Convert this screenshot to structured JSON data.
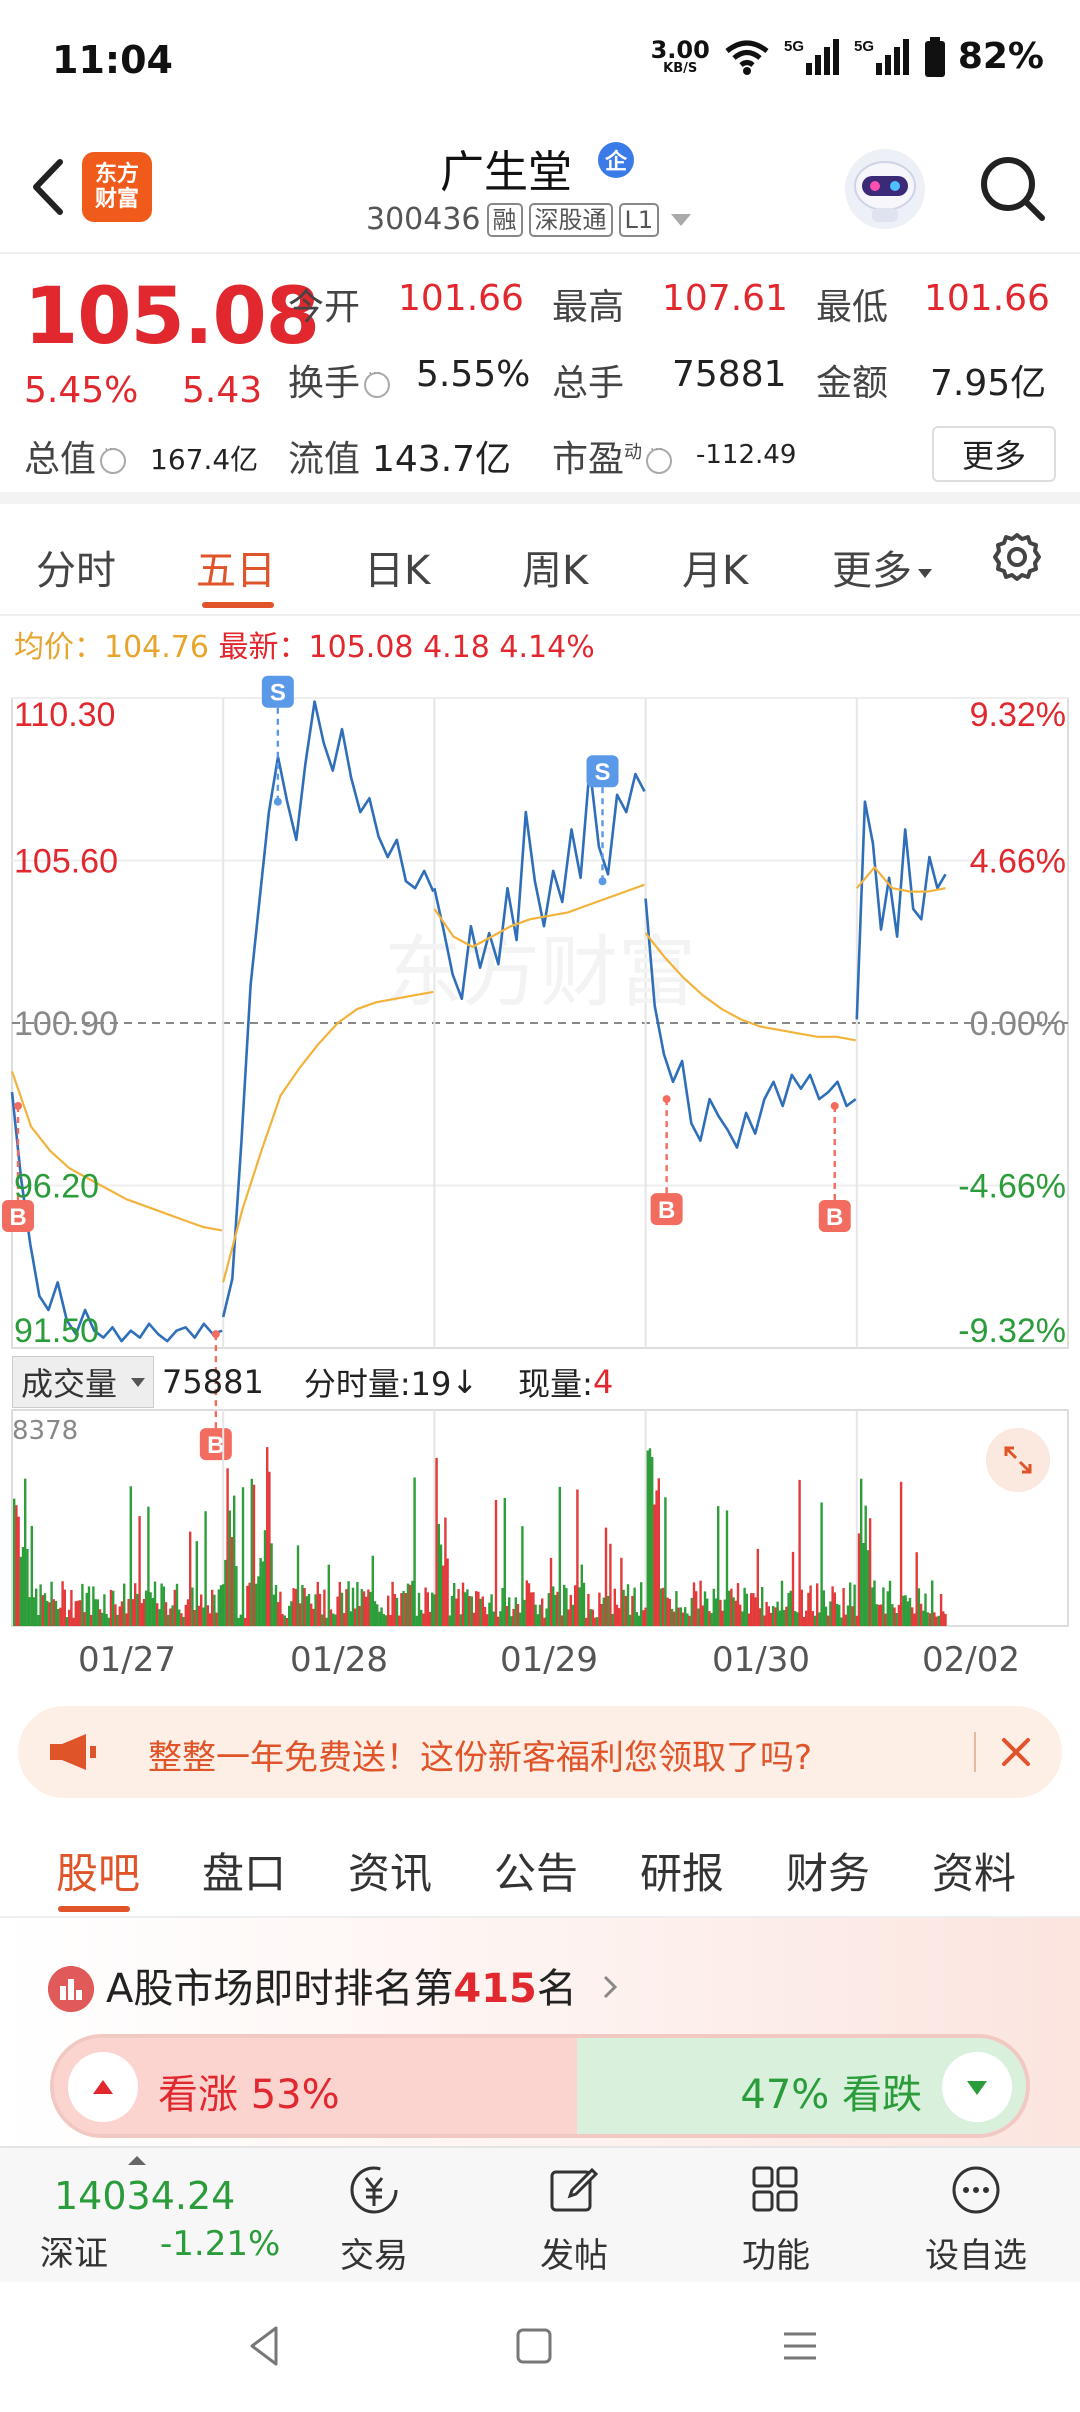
{
  "status": {
    "time": "11:04",
    "net_speed": "3.00",
    "net_unit": "KB/S",
    "signal1": "5G",
    "signal2": "5G",
    "battery": "82%"
  },
  "header": {
    "logo_line1": "东方",
    "logo_line2": "财富",
    "stock_name": "广生堂",
    "qi_badge": "企",
    "code": "300436",
    "tags": [
      "融",
      "深股通",
      "L1"
    ]
  },
  "quote": {
    "price": "105.08",
    "change_pct": "5.45%",
    "change": "5.43",
    "open_label": "今开",
    "open": "101.66",
    "high_label": "最高",
    "high": "107.61",
    "low_label": "最低",
    "low": "101.66",
    "turnover_label": "换手",
    "turnover": "5.55%",
    "volume_label": "总手",
    "volume": "75881",
    "amount_label": "金额",
    "amount": "7.95亿",
    "mcap_label": "总值",
    "mcap": "167.4亿",
    "float_label": "流值",
    "float": "143.7亿",
    "pe_label": "市盈",
    "pe_sup": "动",
    "pe": "-112.49",
    "more": "更多"
  },
  "period_tabs": [
    "分时",
    "五日",
    "日K",
    "周K",
    "月K",
    "更多"
  ],
  "avg": {
    "avg_label": "均价：",
    "avg_value": "104.76",
    "latest_label": "最新：",
    "latest_value": "105.08",
    "latest_change": "4.18",
    "latest_pct": "4.14%"
  },
  "chart_data": {
    "type": "line",
    "title": "",
    "dates": [
      "01/27",
      "01/28",
      "01/29",
      "01/30",
      "02/02"
    ],
    "ylim": [
      91.5,
      110.3
    ],
    "y_ticks_left": [
      "110.30",
      "105.60",
      "100.90",
      "96.20",
      "91.50"
    ],
    "y_ticks_right": [
      "9.32%",
      "4.66%",
      "0.00%",
      "-4.66%",
      "-9.32%"
    ],
    "reference_price": 100.9,
    "series": [
      {
        "color": "#2f6fba",
        "days": [
          [
            98.9,
            96.4,
            94.5,
            93.0,
            92.6,
            93.4,
            92.3,
            91.9,
            92.6,
            92.0,
            91.8,
            92.1,
            91.7,
            92.0,
            91.8,
            92.2,
            91.9,
            91.7,
            92.0,
            92.1,
            91.8,
            92.2,
            91.9,
            92.0
          ],
          [
            92.4,
            93.5,
            97.5,
            102.0,
            104.5,
            107.0,
            108.6,
            107.3,
            106.2,
            108.4,
            110.2,
            109.0,
            108.2,
            109.4,
            108.0,
            107.0,
            107.4,
            106.3,
            105.7,
            106.2,
            105.0,
            104.8,
            105.3,
            104.7
          ],
          [
            104.8,
            103.6,
            102.3,
            101.6,
            103.7,
            102.5,
            103.5,
            102.6,
            104.8,
            103.3,
            107.0,
            105.0,
            103.7,
            105.3,
            104.4,
            106.5,
            105.1,
            108.3,
            106.0,
            105.2,
            107.5,
            107.0,
            108.1,
            107.6
          ],
          [
            104.5,
            101.4,
            100.0,
            99.2,
            99.8,
            98.0,
            97.5,
            98.7,
            98.2,
            97.8,
            97.3,
            98.3,
            97.7,
            98.7,
            99.2,
            98.5,
            99.4,
            99.0,
            99.4,
            98.7,
            98.9,
            99.2,
            98.5,
            98.7
          ],
          [
            101.0,
            107.3,
            106.1,
            103.6,
            105.1,
            103.4,
            106.5,
            104.2,
            103.9,
            105.7,
            104.8,
            105.2
          ]
        ]
      },
      {
        "color": "#f2b33d",
        "days": [
          [
            99.5,
            97.9,
            97.2,
            96.7,
            96.4,
            96.1,
            95.8,
            95.6,
            95.4,
            95.2,
            95.0,
            94.9
          ],
          [
            93.4,
            95.5,
            97.2,
            98.8,
            99.6,
            100.3,
            100.9,
            101.3,
            101.5,
            101.6,
            101.7,
            101.8
          ],
          [
            104.2,
            103.4,
            103.1,
            103.4,
            103.7,
            103.9,
            104.0,
            104.1,
            104.3,
            104.5,
            104.7,
            104.9
          ],
          [
            103.5,
            102.8,
            102.2,
            101.7,
            101.3,
            101.0,
            100.8,
            100.7,
            100.6,
            100.5,
            100.5,
            100.4
          ],
          [
            104.8,
            105.4,
            104.8,
            104.7,
            104.7,
            104.8
          ]
        ]
      }
    ],
    "markers": [
      {
        "label": "B",
        "day": 0,
        "pos": 0.0,
        "price": 98.5
      },
      {
        "label": "B",
        "day": 0,
        "pos": 0.97,
        "price": 91.9
      },
      {
        "label": "S",
        "day": 1,
        "pos": 0.26,
        "price": 107.3
      },
      {
        "label": "S",
        "day": 2,
        "pos": 0.8,
        "price": 105.0
      },
      {
        "label": "B",
        "day": 3,
        "pos": 0.1,
        "price": 98.7
      },
      {
        "label": "B",
        "day": 3,
        "pos": 0.9,
        "price": 98.5
      }
    ],
    "volume": {
      "label": "成交量",
      "total": "75881",
      "period_label": "分时量:19",
      "period_arrow": "↓",
      "current_label": "现量:",
      "current": "4",
      "max": "8378"
    }
  },
  "promo": {
    "text": "整整一年免费送！这份新客福利您领取了吗?"
  },
  "bottom_tabs": [
    "股吧",
    "盘口",
    "资讯",
    "公告",
    "研报",
    "财务",
    "资料"
  ],
  "rank": {
    "prefix": "A股市场即时排名第",
    "num": "415",
    "suffix": "名"
  },
  "vote": {
    "up_text": "看涨 53%",
    "down_text": "47% 看跌",
    "up_pct": 53
  },
  "nav": {
    "index_value": "14034.24",
    "index_name": "深证",
    "index_pct": "-1.21%",
    "items": [
      "交易",
      "发帖",
      "功能",
      "设自选"
    ]
  },
  "colors": {
    "red": "#e0282e",
    "green": "#2a9d3a",
    "accent": "#e0542a",
    "price_line": "#2f6fba",
    "avg_line": "#f2b33d"
  }
}
